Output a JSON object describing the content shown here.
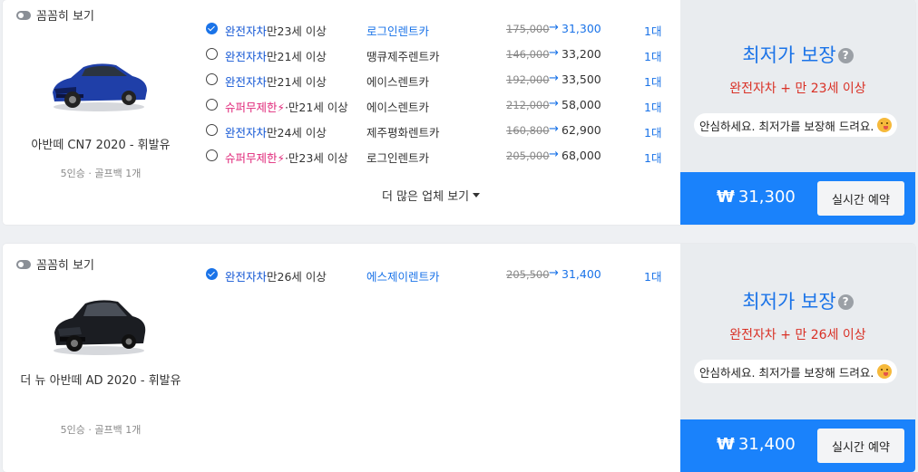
{
  "cards": [
    {
      "toggle_label": "꼼꼼히 보기",
      "car_name": "아반떼 CN7 2020 - 휘발유",
      "car_spec": "5인승 · 골프백 1개",
      "car_color": "#1f3fa8",
      "rows": [
        {
          "checked": true,
          "ins": "완전자차",
          "ins_type": "full",
          "age": "만23세 이상",
          "company": "로그인렌트카",
          "highlight": true,
          "orig": "175,000",
          "sale": "31,300",
          "count": "1대"
        },
        {
          "checked": false,
          "ins": "완전자차",
          "ins_type": "full",
          "age": "만21세 이상",
          "company": "땡큐제주렌트카",
          "highlight": false,
          "orig": "146,000",
          "sale": "33,200",
          "count": "1대"
        },
        {
          "checked": false,
          "ins": "완전자차",
          "ins_type": "full",
          "age": "만21세 이상",
          "company": "에이스렌트카",
          "highlight": false,
          "orig": "192,000",
          "sale": "33,500",
          "count": "1대"
        },
        {
          "checked": false,
          "ins": "슈퍼무제한",
          "ins_type": "super",
          "age": "·만21세 이상",
          "company": "에이스렌트카",
          "highlight": false,
          "orig": "212,000",
          "sale": "58,000",
          "count": "1대"
        },
        {
          "checked": false,
          "ins": "완전자차",
          "ins_type": "full",
          "age": "만24세 이상",
          "company": "제주평화렌트카",
          "highlight": false,
          "orig": "160,800",
          "sale": "62,900",
          "count": "1대"
        },
        {
          "checked": false,
          "ins": "슈퍼무제한",
          "ins_type": "super",
          "age": "·만23세 이상",
          "company": "로그인렌트카",
          "highlight": false,
          "orig": "205,000",
          "sale": "68,000",
          "count": "1대"
        }
      ],
      "more_label": "더 많은 업체 보기",
      "best_title": "최저가 보장",
      "best_cond": "완전자차 + 만 23세 이상",
      "bubble_text": "안심하세요. 최저가를 보장해 드려요.",
      "price_symbol": "₩",
      "price": "31,300",
      "book_label": "실시간 예약"
    },
    {
      "toggle_label": "꼼꼼히 보기",
      "car_name": "더 뉴 아반떼 AD 2020 - 휘발유",
      "car_spec": "5인승 · 골프백 1개",
      "car_color": "#1b1d22",
      "rows": [
        {
          "checked": true,
          "ins": "완전자차",
          "ins_type": "full",
          "age": "만26세 이상",
          "company": "에스제이렌트카",
          "highlight": true,
          "orig": "205,500",
          "sale": "31,400",
          "count": "1대"
        }
      ],
      "more_label": "",
      "best_title": "최저가 보장",
      "best_cond": "완전자차 + 만 26세 이상",
      "bubble_text": "안심하세요. 최저가를 보장해 드려요.",
      "price_symbol": "₩",
      "price": "31,400",
      "book_label": "실시간 예약"
    }
  ],
  "colors": {
    "accent": "#1a82fb",
    "full_insurance": "#1155d4",
    "super_insurance": "#e0287a",
    "condition_red": "#d93025"
  },
  "icons": {
    "toggle": "toggle-icon",
    "help": "question-circle-icon",
    "bolt": "lightning-bolt-icon",
    "emoji": "kissing-face-icon",
    "caret": "caret-down-icon"
  }
}
